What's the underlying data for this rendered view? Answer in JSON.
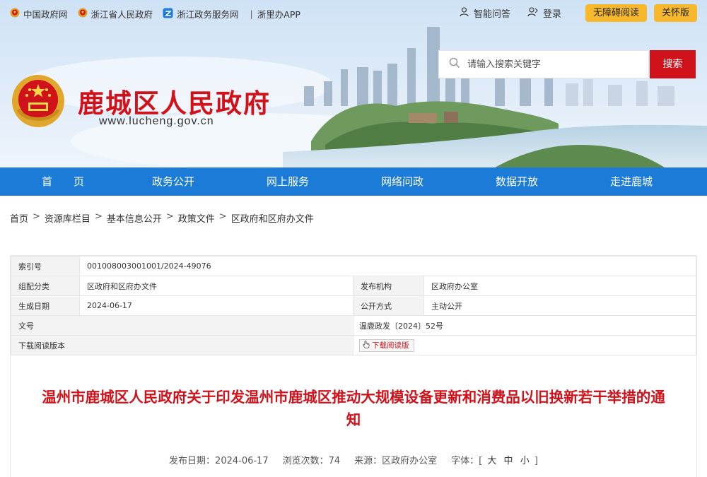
{
  "topbar": {
    "links": [
      {
        "label": "中国政府网",
        "icon": "national-emblem-icon"
      },
      {
        "label": "浙江省人民政府",
        "icon": "national-emblem-icon"
      },
      {
        "label": "浙江政务服务网",
        "icon": "zjzw-service-icon"
      },
      {
        "label": "浙里办APP",
        "icon": ""
      }
    ],
    "app_separator": "|",
    "qa_label": "智能问答",
    "login_label": "登录",
    "accessible_label": "无障碍阅读",
    "care_label": "关怀版"
  },
  "header": {
    "site_title": "鹿城区人民政府",
    "site_url": "www.lucheng.gov.cn"
  },
  "search": {
    "placeholder": "请输入搜索关键字",
    "button_label": "搜索"
  },
  "nav": {
    "items": [
      "首　　页",
      "政务公开",
      "网上服务",
      "网络问政",
      "数据开放",
      "走进鹿城"
    ]
  },
  "breadcrumb": [
    "首页",
    "资源库栏目",
    "基本信息公开",
    "政策文件",
    "区政府和区府办文件"
  ],
  "breadcrumb_sep": ">",
  "info": {
    "index_label": "索引号",
    "index_value": "001008003001001/2024-49076",
    "category_label": "组配分类",
    "category_value": "区政府和区府办文件",
    "issuer_label": "发布机构",
    "issuer_value": "区政府办公室",
    "date_label": "生成日期",
    "date_value": "2024-06-17",
    "open_label": "公开方式",
    "open_value": "主动公开",
    "docno_label": "文号",
    "docno_value": "温鹿政发〔2024〕52号",
    "download_label": "下载阅读版本",
    "download_button": "下载阅读版"
  },
  "doc": {
    "title": "温州市鹿城区人民政府关于印发温州市鹿城区推动大规模设备更新和消费品以旧换新若干举措的通知",
    "publish_date": "发布日期：2024-06-17",
    "views": "浏览次数：74",
    "source": "来源：区政府办公室",
    "font_label": "字体：[",
    "font_large": "大",
    "font_medium": "中",
    "font_small": "小",
    "font_end": "]"
  },
  "colors": {
    "brand_red": "#d0121b",
    "nav_blue": "#1b7bd6",
    "pill_yellow": "#f7b92b"
  }
}
